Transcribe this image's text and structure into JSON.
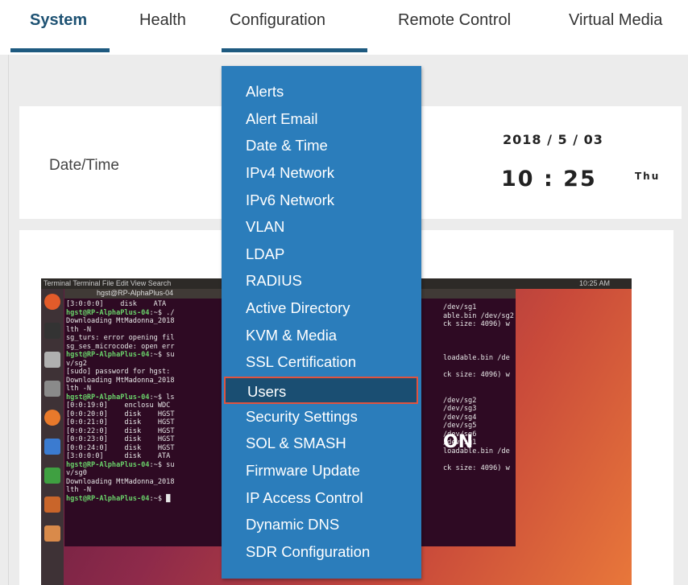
{
  "nav": {
    "tabs": [
      "System",
      "Health",
      "Configuration",
      "Remote Control",
      "Virtual Media"
    ],
    "active_tab": "System",
    "open_tab": "Configuration"
  },
  "datetime": {
    "label": "Date/Time",
    "date": "2018 / 5 / 03",
    "time": "10 : 25",
    "day": "Thu"
  },
  "config_menu": {
    "items": [
      "Alerts",
      "Alert Email",
      "Date & Time",
      "IPv4 Network",
      "IPv6 Network",
      "VLAN",
      "LDAP",
      "RADIUS",
      "Active Directory",
      "KVM & Media",
      "SSL Certification",
      "Users",
      "Security Settings",
      "SOL & SMASH",
      "Firmware Update",
      "IP Access Control",
      "Dynamic DNS",
      "SDR Configuration"
    ],
    "highlighted": "Users"
  },
  "preview": {
    "menubar_left": "Terminal  Terminal  File  Edit  View  Search",
    "menubar_right": "10:25 AM",
    "window_title": "hgst@RP-AlphaPlus-04",
    "overlay_text": "ON"
  },
  "colors": {
    "menu_bg": "#2b7dbb",
    "menu_selected_bg": "#1a4e72",
    "selection_border": "#e0533f",
    "tab_underline": "#1e5a80"
  }
}
